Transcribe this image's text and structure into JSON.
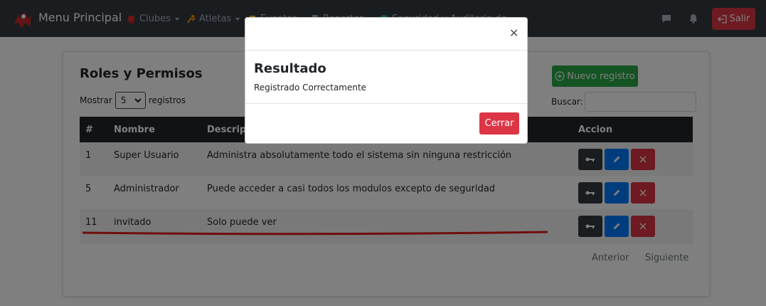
{
  "navbar": {
    "brand": "Menu Principal",
    "items": [
      {
        "label": "Clubes",
        "icon": "boxing-glove-icon"
      },
      {
        "label": "Atletas",
        "icon": "athlete-icon"
      },
      {
        "label": "Eventos",
        "icon": "trophy-icon"
      },
      {
        "label": "Reportes",
        "icon": "document-icon"
      },
      {
        "label": "Seguridad y Auditoria",
        "icon": "globe-icon"
      },
      {
        "label": "de",
        "icon": ""
      }
    ],
    "chat_icon": "chat-icon",
    "bell_icon": "bell-icon",
    "logout_label": "Salir",
    "accent": "#343a40"
  },
  "page": {
    "title": "Roles y Permisos",
    "new_label": "Nuevo registro",
    "length_prefix": "Mostrar",
    "length_value": "5",
    "length_suffix": "registros",
    "search_label": "Buscar:",
    "search_value": "",
    "columns": [
      "#",
      "Nombre",
      "Descripcion",
      "Accion"
    ],
    "rows": [
      {
        "id": "1",
        "name": "Super Usuario",
        "description": "Administra absolutamente todo el sistema sin ninguna restricción"
      },
      {
        "id": "5",
        "name": "Administrador",
        "description": "Puede acceder a casi todos los modulos excepto de seguridad"
      },
      {
        "id": "11",
        "name": "invitado",
        "description": "Solo puede ver"
      }
    ],
    "prev_label": "Anterior",
    "next_label": "Siguiente"
  },
  "modal": {
    "close_icon": "close-icon",
    "title": "Resultado",
    "message": "Registrado Correctamente",
    "button_label": "Cerrar"
  },
  "colors": {
    "success": "#28a745",
    "danger": "#dc3545",
    "primary": "#007bff",
    "dark": "#343a40"
  }
}
